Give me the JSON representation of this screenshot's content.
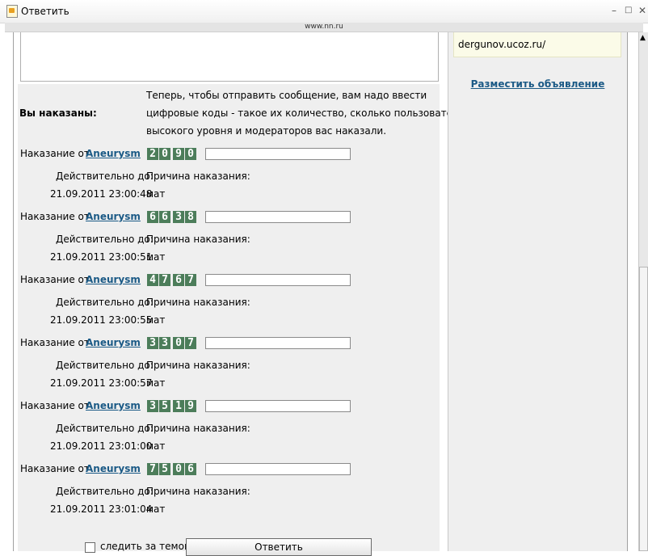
{
  "window": {
    "title": "Ответить",
    "minimize": "–",
    "maximize": "□",
    "close": "✕"
  },
  "urlbar": {
    "url": "www.nn.ru"
  },
  "sidebar": {
    "ad_text": "dergunov.ucoz.ru/",
    "post_ad_link": "Разместить объявление"
  },
  "punishment": {
    "heading": "Вы наказаны:",
    "instructions": [
      "Теперь, чтобы отправить сообщение, вам надо ввести",
      "цифровые коды - такое их количество, сколько пользователей",
      "высокого уровня и модераторов вас наказали."
    ],
    "from_label": "Наказание от",
    "valid_label": "Действительно до:",
    "reason_label": "Причина наказания:",
    "items": [
      {
        "user": "Aneurysm",
        "code": [
          "2",
          "0",
          "9",
          "0"
        ],
        "valid_until": "21.09.2011 23:00:48",
        "reason": "мат"
      },
      {
        "user": "Aneurysm",
        "code": [
          "6",
          "6",
          "3",
          "8"
        ],
        "valid_until": "21.09.2011 23:00:51",
        "reason": "мат"
      },
      {
        "user": "Aneurysm",
        "code": [
          "4",
          "7",
          "6",
          "7"
        ],
        "valid_until": "21.09.2011 23:00:55",
        "reason": "мат"
      },
      {
        "user": "Aneurysm",
        "code": [
          "3",
          "3",
          "0",
          "7"
        ],
        "valid_until": "21.09.2011 23:00:57",
        "reason": "мат"
      },
      {
        "user": "Aneurysm",
        "code": [
          "3",
          "5",
          "1",
          "9"
        ],
        "valid_until": "21.09.2011 23:01:00",
        "reason": "мат"
      },
      {
        "user": "Aneurysm",
        "code": [
          "7",
          "5",
          "0",
          "6"
        ],
        "valid_until": "21.09.2011 23:01:04",
        "reason": "мат"
      }
    ]
  },
  "footer": {
    "watch_label": "следить за темой",
    "submit_label": "Ответить"
  },
  "colors": {
    "captcha_bg": "#4c7d5a",
    "link": "#1b5a86",
    "panel": "#efefef"
  }
}
